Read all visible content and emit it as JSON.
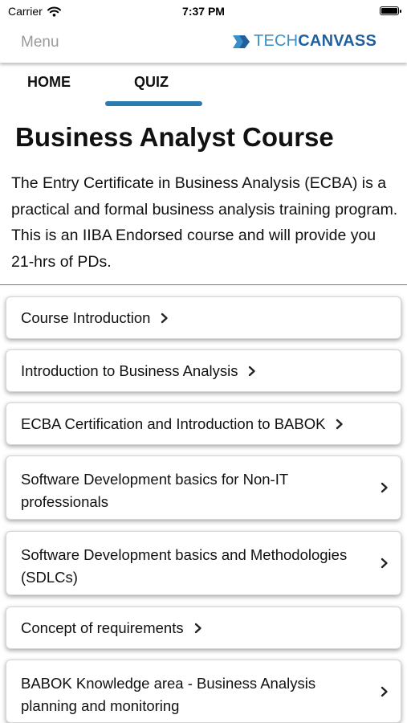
{
  "status_bar": {
    "carrier": "Carrier",
    "time": "7:37 PM"
  },
  "nav": {
    "menu_label": "Menu",
    "logo_tech": "TECH",
    "logo_canvass": "CANVASS"
  },
  "tabs": [
    {
      "label": "HOME",
      "selected": false
    },
    {
      "label": "QUIZ",
      "selected": true
    }
  ],
  "course": {
    "title": "Business Analyst Course",
    "description": "The Entry Certificate in Business Analysis (ECBA) is a practical and formal business analysis training program. This is an IIBA Endorsed course and will provide you 21-hrs of PDs."
  },
  "modules": [
    {
      "label": "Course Introduction"
    },
    {
      "label": "Introduction to Business Analysis"
    },
    {
      "label": "ECBA Certification and Introduction to BABOK"
    },
    {
      "label": "Software Development basics for Non-IT professionals"
    },
    {
      "label": "Software Development basics and Methodologies (SDLCs)"
    },
    {
      "label": "Concept of requirements"
    },
    {
      "label": "BABOK Knowledge area - Business Analysis planning and monitoring"
    }
  ],
  "colors": {
    "accent": "#2b7bb0",
    "logo_light": "#3a8fc8",
    "logo_dark": "#1f5f9e",
    "menu_text": "#9a9a9a"
  }
}
